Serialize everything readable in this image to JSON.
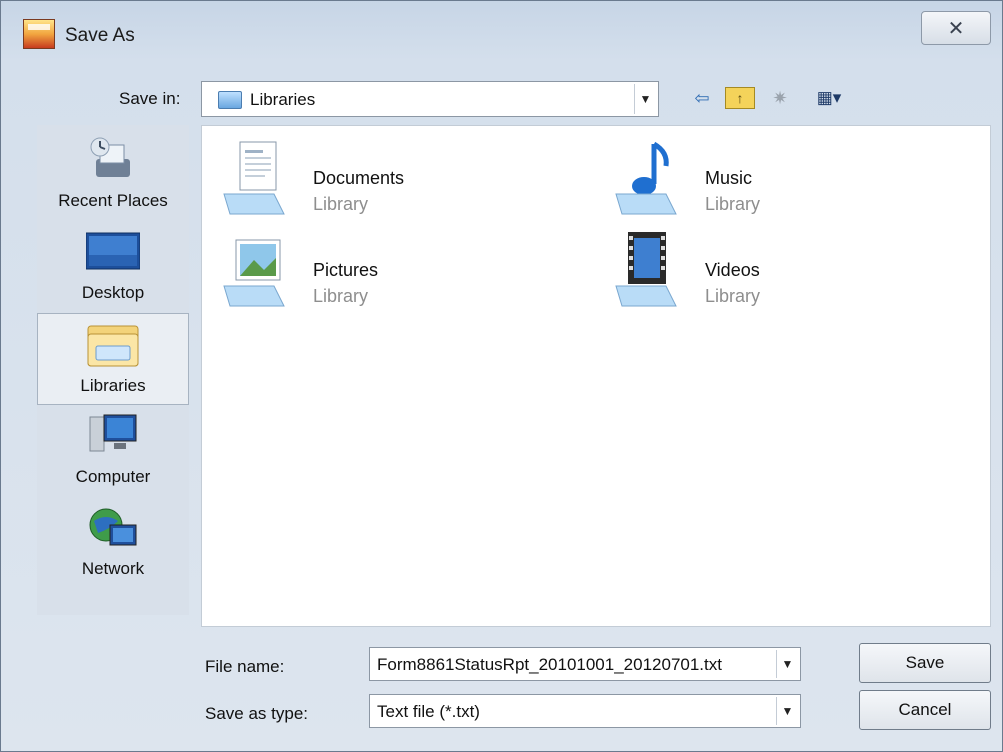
{
  "window": {
    "title": "Save As",
    "close_glyph": "✕"
  },
  "save_in": {
    "label": "Save in:",
    "value": "Libraries"
  },
  "toolbar": {
    "back": "⇦",
    "up": "↑",
    "new_folder": "✷",
    "view": "▦▾"
  },
  "places": [
    {
      "label": "Recent Places",
      "icon": "recent-places-icon"
    },
    {
      "label": "Desktop",
      "icon": "desktop-icon"
    },
    {
      "label": "Libraries",
      "icon": "libraries-icon",
      "selected": true
    },
    {
      "label": "Computer",
      "icon": "computer-icon"
    },
    {
      "label": "Network",
      "icon": "network-icon"
    }
  ],
  "libraries": [
    {
      "name": "Documents",
      "type": "Library",
      "icon": "documents-library-icon"
    },
    {
      "name": "Music",
      "type": "Library",
      "icon": "music-library-icon"
    },
    {
      "name": "Pictures",
      "type": "Library",
      "icon": "pictures-library-icon"
    },
    {
      "name": "Videos",
      "type": "Library",
      "icon": "videos-library-icon"
    }
  ],
  "file_name": {
    "label": "File name:",
    "value": "Form8861StatusRpt_20101001_20120701.txt"
  },
  "save_as_type": {
    "label": "Save as type:",
    "value": "Text file (*.txt)"
  },
  "buttons": {
    "save": "Save",
    "cancel": "Cancel"
  },
  "dropdown_glyph": "▼",
  "colors": {
    "selection_bg": "#eaeef3",
    "library_subtitle": "#8e8e8e",
    "frame": "#c7d5e6"
  }
}
